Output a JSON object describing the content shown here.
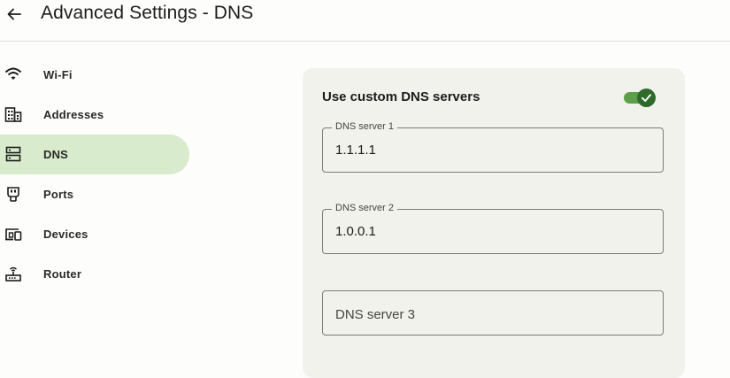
{
  "header": {
    "title": "Advanced Settings - DNS",
    "back_icon": "arrow-left-icon"
  },
  "sidebar": {
    "items": [
      {
        "label": "Wi-Fi",
        "icon": "wifi-icon",
        "active": false
      },
      {
        "label": "Addresses",
        "icon": "building-icon",
        "active": false
      },
      {
        "label": "DNS",
        "icon": "dns-server-icon",
        "active": true
      },
      {
        "label": "Ports",
        "icon": "plug-icon",
        "active": false
      },
      {
        "label": "Devices",
        "icon": "devices-icon",
        "active": false
      },
      {
        "label": "Router",
        "icon": "router-icon",
        "active": false
      }
    ]
  },
  "dns": {
    "toggle_label": "Use custom DNS servers",
    "toggle_on": true,
    "server1": {
      "label": "DNS server 1",
      "value": "1.1.1.1"
    },
    "server2": {
      "label": "DNS server 2",
      "value": "1.0.0.1"
    },
    "server3": {
      "placeholder": "DNS server 3",
      "value": ""
    }
  },
  "colors": {
    "active_nav": "#d8ebcd",
    "card_bg": "#f1f2ec",
    "toggle_accent": "#2e6a2a"
  }
}
